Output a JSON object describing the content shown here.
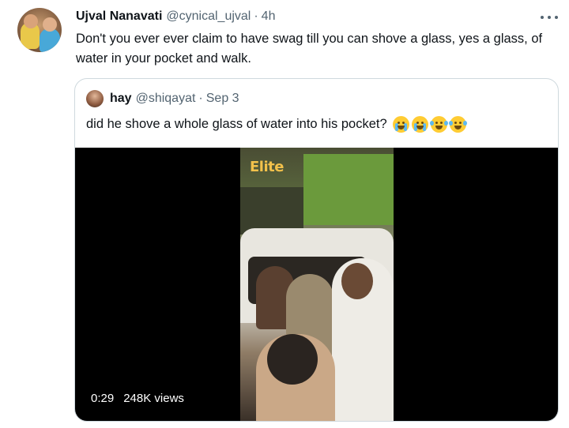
{
  "tweet": {
    "author_name": "Ujval Nanavati",
    "handle": "@cynical_ujval",
    "separator": "·",
    "time": "4h",
    "avatar_icon": "avatar-photo",
    "more_icon": "more-options-icon",
    "text": "Don't you ever ever claim to have swag till you can shove a glass, yes a glass, of water in your pocket and walk."
  },
  "quoted": {
    "author_name": "hay",
    "handle": "@shiqayat",
    "separator": "·",
    "date": "Sep 3",
    "text": "did he shove a whole glass of water into his pocket?",
    "emojis": [
      "loudly-crying-face",
      "loudly-crying-face",
      "face-with-tears-of-joy",
      "face-with-tears-of-joy"
    ],
    "video": {
      "watermark": "Elite",
      "duration": "0:29",
      "views": "248K views"
    }
  },
  "colors": {
    "text_primary": "#0f1419",
    "text_secondary": "#536471",
    "border": "#cfd9de",
    "video_bg": "#000000",
    "watermark": "#f2c14b"
  }
}
